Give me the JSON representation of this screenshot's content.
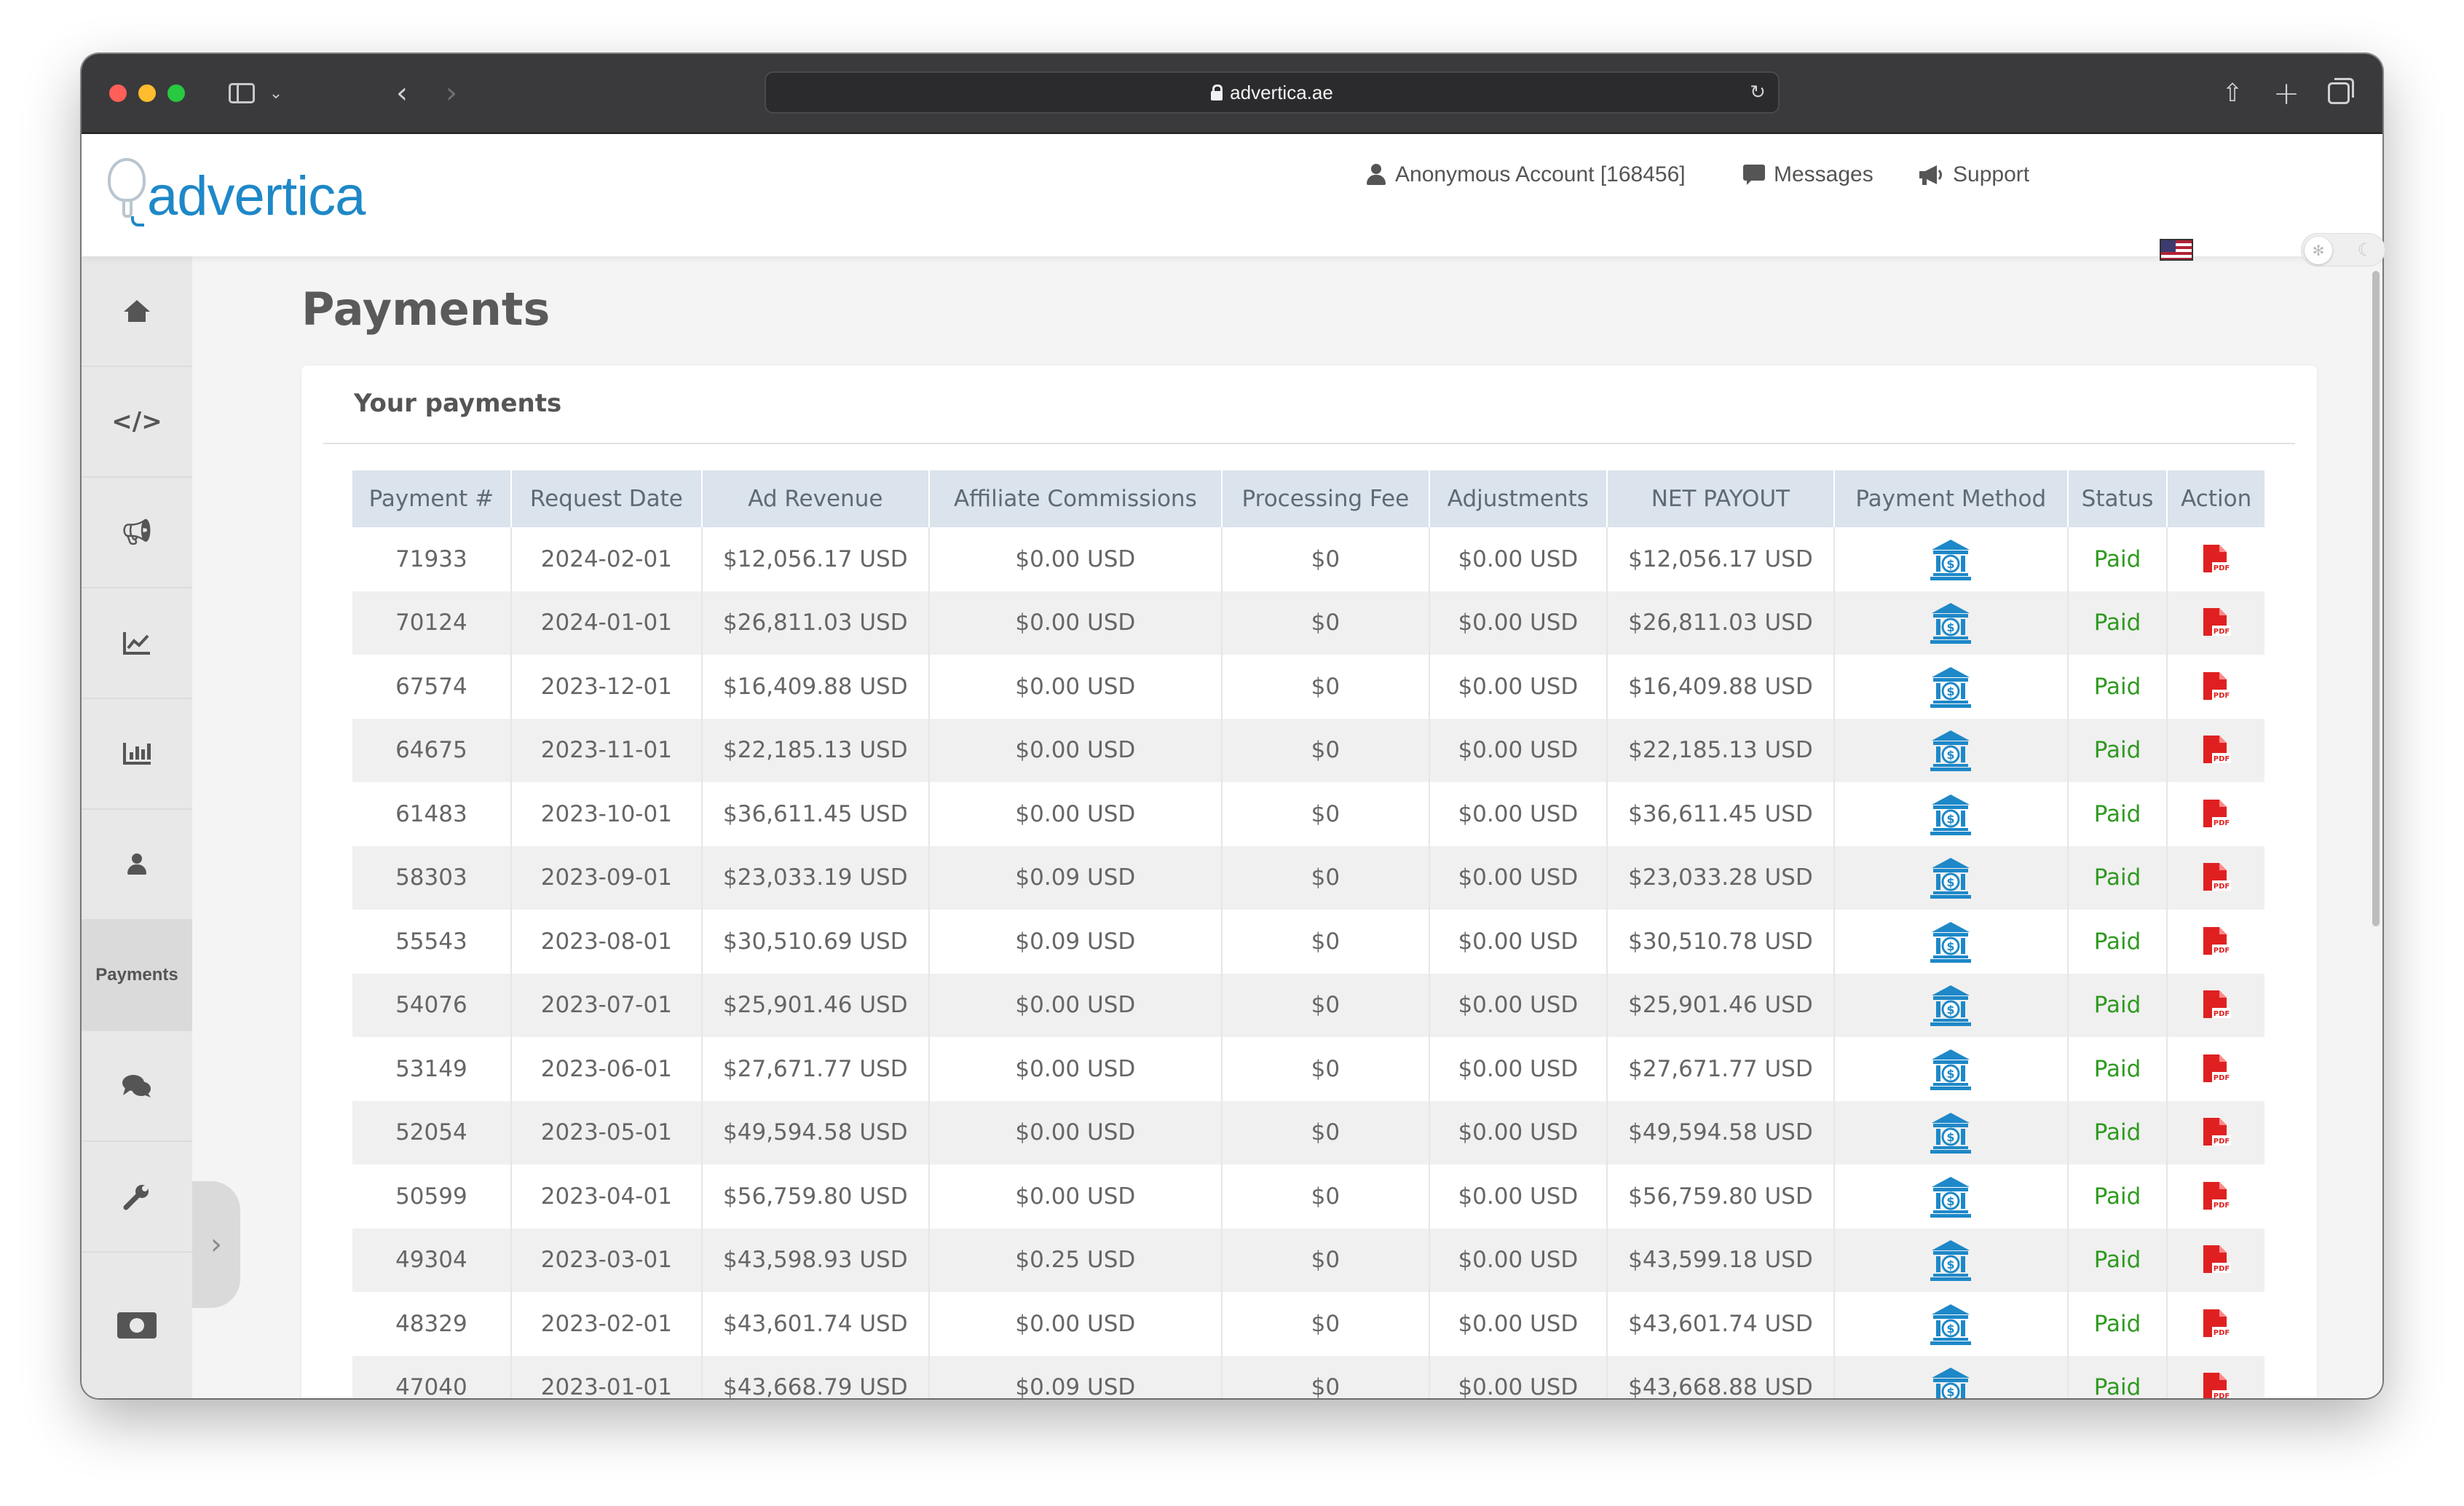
{
  "browser": {
    "url": "advertica.ae"
  },
  "header": {
    "logo_text": "advertica",
    "account_label": "Anonymous Account [168456]",
    "messages_label": "Messages",
    "support_label": "Support",
    "language_flag": "us-flag-icon"
  },
  "leftnav": {
    "items": [
      {
        "icon": "home-icon"
      },
      {
        "icon": "code-icon"
      },
      {
        "icon": "megaphone-icon"
      },
      {
        "icon": "line-chart-icon"
      },
      {
        "icon": "bar-chart-icon"
      },
      {
        "icon": "user-icon"
      },
      {
        "label": "Payments"
      },
      {
        "icon": "comments-icon"
      },
      {
        "icon": "wrench-icon"
      },
      {
        "icon": "money-icon"
      }
    ]
  },
  "page": {
    "title": "Payments",
    "card_title": "Your payments"
  },
  "table": {
    "headers": [
      "Payment #",
      "Request Date",
      "Ad Revenue",
      "Affiliate Commissions",
      "Processing Fee",
      "Adjustments",
      "NET PAYOUT",
      "Payment Method",
      "Status",
      "Action"
    ],
    "rows": [
      [
        "71933",
        "2024-02-01",
        "$12,056.17 USD",
        "$0.00 USD",
        "$0",
        "$0.00 USD",
        "$12,056.17 USD",
        "Paid"
      ],
      [
        "70124",
        "2024-01-01",
        "$26,811.03 USD",
        "$0.00 USD",
        "$0",
        "$0.00 USD",
        "$26,811.03 USD",
        "Paid"
      ],
      [
        "67574",
        "2023-12-01",
        "$16,409.88 USD",
        "$0.00 USD",
        "$0",
        "$0.00 USD",
        "$16,409.88 USD",
        "Paid"
      ],
      [
        "64675",
        "2023-11-01",
        "$22,185.13 USD",
        "$0.00 USD",
        "$0",
        "$0.00 USD",
        "$22,185.13 USD",
        "Paid"
      ],
      [
        "61483",
        "2023-10-01",
        "$36,611.45 USD",
        "$0.00 USD",
        "$0",
        "$0.00 USD",
        "$36,611.45 USD",
        "Paid"
      ],
      [
        "58303",
        "2023-09-01",
        "$23,033.19 USD",
        "$0.09 USD",
        "$0",
        "$0.00 USD",
        "$23,033.28 USD",
        "Paid"
      ],
      [
        "55543",
        "2023-08-01",
        "$30,510.69 USD",
        "$0.09 USD",
        "$0",
        "$0.00 USD",
        "$30,510.78 USD",
        "Paid"
      ],
      [
        "54076",
        "2023-07-01",
        "$25,901.46 USD",
        "$0.00 USD",
        "$0",
        "$0.00 USD",
        "$25,901.46 USD",
        "Paid"
      ],
      [
        "53149",
        "2023-06-01",
        "$27,671.77 USD",
        "$0.00 USD",
        "$0",
        "$0.00 USD",
        "$27,671.77 USD",
        "Paid"
      ],
      [
        "52054",
        "2023-05-01",
        "$49,594.58 USD",
        "$0.00 USD",
        "$0",
        "$0.00 USD",
        "$49,594.58 USD",
        "Paid"
      ],
      [
        "50599",
        "2023-04-01",
        "$56,759.80 USD",
        "$0.00 USD",
        "$0",
        "$0.00 USD",
        "$56,759.80 USD",
        "Paid"
      ],
      [
        "49304",
        "2023-03-01",
        "$43,598.93 USD",
        "$0.25 USD",
        "$0",
        "$0.00 USD",
        "$43,599.18 USD",
        "Paid"
      ],
      [
        "48329",
        "2023-02-01",
        "$43,601.74 USD",
        "$0.00 USD",
        "$0",
        "$0.00 USD",
        "$43,601.74 USD",
        "Paid"
      ],
      [
        "47040",
        "2023-01-01",
        "$43,668.79 USD",
        "$0.09 USD",
        "$0",
        "$0.00 USD",
        "$43,668.88 USD",
        "Paid"
      ]
    ],
    "payment_method_icon": "bank-icon",
    "action_icon": "pdf-icon"
  },
  "colors": {
    "brand": "#1e88c8",
    "paid": "#2e9a1f",
    "pdf": "#e02020",
    "header_row": "#dbe3ec"
  }
}
